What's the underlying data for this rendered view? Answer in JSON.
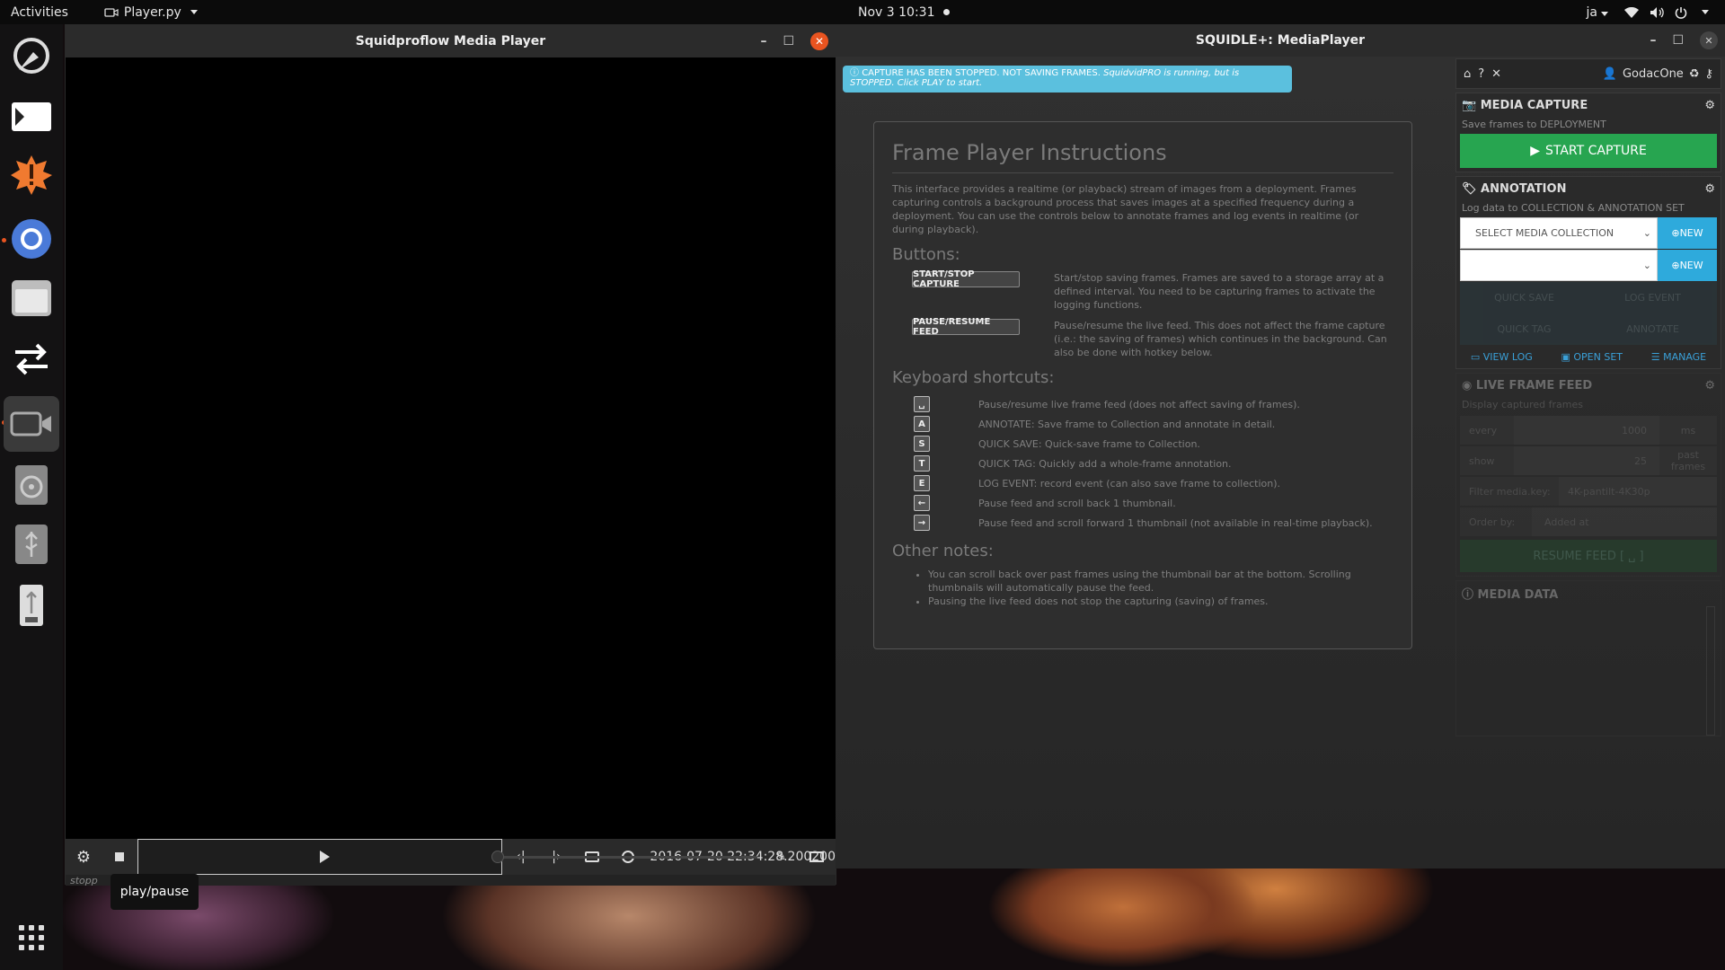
{
  "topbar": {
    "activities": "Activities",
    "app_name": "Player.py",
    "clock": "Nov 3  10:31",
    "lang": "ja"
  },
  "player_window": {
    "title": "Squidproflow Media Player",
    "timestamp": "2016-07-20 22:34:28.200200",
    "status": "stopp",
    "tooltip": "play/pause"
  },
  "mediaplayer_window": {
    "title": "SQUIDLE+: MediaPlayer",
    "alert": {
      "text": "CAPTURE HAS BEEN STOPPED. NOT SAVING FRAMES.",
      "italic": "SquidvidPRO is running, but is STOPPED. Click PLAY to start."
    },
    "instructions": {
      "title": "Frame Player Instructions",
      "intro": "This interface provides a realtime (or playback) stream of images from a deployment. Frames capturing controls a background process that saves images at a specified frequency during a deployment. You can use the controls below to annotate frames and log events in realtime (or during playback).",
      "buttons_heading": "Buttons:",
      "buttons": [
        {
          "label": "START/STOP CAPTURE",
          "desc": "Start/stop saving frames. Frames are saved to a storage array at a defined interval. You need to be capturing frames to activate the logging functions."
        },
        {
          "label": "PAUSE/RESUME FEED",
          "desc": "Pause/resume the live feed. This does not affect the frame capture (i.e.: the saving of frames) which continues in the background. Can also be done with hotkey below."
        }
      ],
      "shortcuts_heading": "Keyboard shortcuts:",
      "shortcuts": [
        {
          "key": "␣",
          "desc": "Pause/resume live frame feed (does not affect saving of frames)."
        },
        {
          "key": "A",
          "desc": "ANNOTATE: Save frame to Collection and annotate in detail."
        },
        {
          "key": "S",
          "desc": "QUICK SAVE: Quick-save frame to Collection."
        },
        {
          "key": "T",
          "desc": "QUICK TAG: Quickly add a whole-frame annotation."
        },
        {
          "key": "E",
          "desc": "LOG EVENT: record event (can also save frame to collection)."
        },
        {
          "key": "←",
          "desc": "Pause feed and scroll back 1 thumbnail."
        },
        {
          "key": "→",
          "desc": "Pause feed and scroll forward 1 thumbnail (not available in real-time playback)."
        }
      ],
      "notes_heading": "Other notes:",
      "notes": [
        "You can scroll back over past frames using the thumbnail bar at the bottom. Scrolling thumbnails will automatically pause the feed.",
        "Pausing the live feed does not stop the capturing (saving) of frames."
      ]
    },
    "panel": {
      "user": "GodacOne",
      "media_capture": {
        "title": "MEDIA CAPTURE",
        "sub": "Save frames to DEPLOYMENT",
        "button": "START CAPTURE"
      },
      "annotation": {
        "title": "ANNOTATION",
        "sub": "Log data to COLLECTION & ANNOTATION SET",
        "select_placeholder": "SELECT MEDIA COLLECTION",
        "new_label": "NEW",
        "quick_save": "QUICK SAVE",
        "log_event": "LOG EVENT",
        "quick_tag": "QUICK TAG",
        "annotate": "ANNOTATE",
        "view_log": "VIEW LOG",
        "open_set": "OPEN SET",
        "manage": "MANAGE"
      },
      "live_feed": {
        "title": "LIVE FRAME FEED",
        "sub": "Display captured frames",
        "every_label": "every",
        "every_value": "1000",
        "every_unit": "ms",
        "show_label": "show",
        "show_value": "25",
        "show_unit": "past frames",
        "filter_label": "Filter media.key:",
        "filter_value": "4K-pantilt-4K30p",
        "order_label": "Order by:",
        "order_value": "Added at",
        "resume": "RESUME FEED [ ␣ ]"
      },
      "media_data": {
        "title": "MEDIA DATA"
      }
    }
  },
  "colors": {
    "accent": "#e95420",
    "green": "#27a550",
    "info": "#5bc0de",
    "new_btn": "#2eaadc"
  }
}
